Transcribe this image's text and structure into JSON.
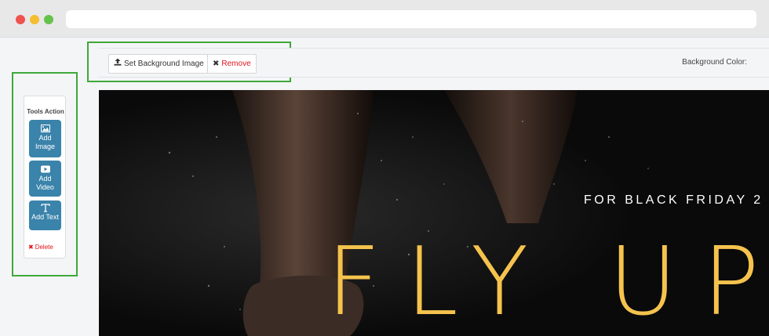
{
  "window": {
    "controls": [
      "close",
      "minimize",
      "maximize"
    ]
  },
  "tools": {
    "title": "Tools Action",
    "buttons": [
      {
        "label_line1": "Add",
        "label_line2": "Image",
        "icon": "image-icon"
      },
      {
        "label_line1": "Add",
        "label_line2": "Video",
        "icon": "video-icon"
      },
      {
        "label_line1": "Add Text",
        "label_line2": "",
        "icon": "text-icon"
      }
    ],
    "delete_label": "Delete"
  },
  "toolbar": {
    "set_background_label": "Set Background Image",
    "remove_label": "Remove",
    "background_color_label": "Background Color:"
  },
  "canvas": {
    "subheading": "FOR BLACK FRIDAY 2",
    "headline": "FLY UP"
  },
  "colors": {
    "tool_button": "#3a83aa",
    "delete": "#e0141b",
    "highlight": "#3fa83a",
    "headline": "#f5c34d"
  }
}
